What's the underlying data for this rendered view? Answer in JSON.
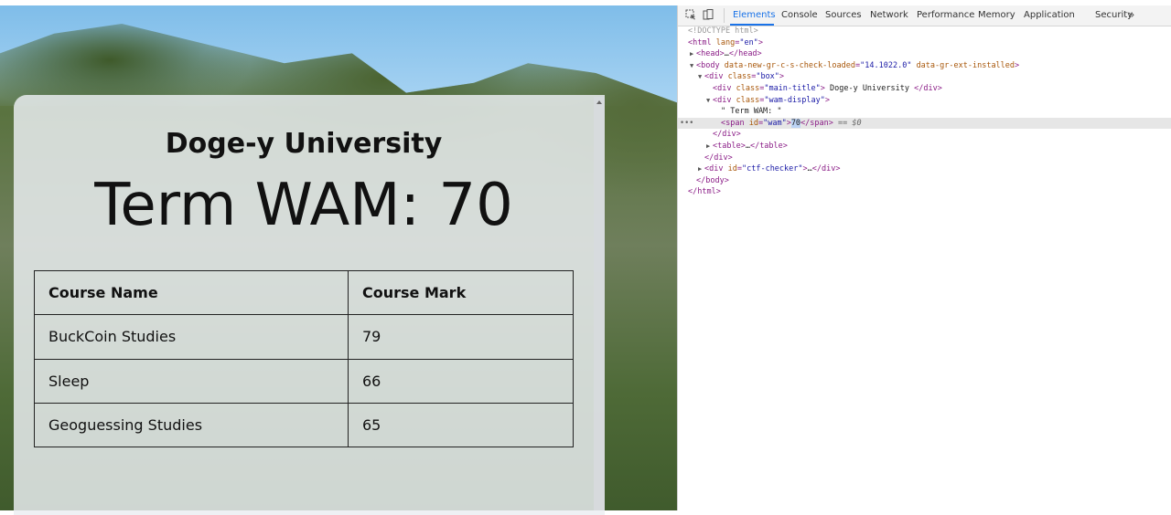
{
  "page": {
    "main_title": "Doge-y University",
    "wam_label": "Term WAM:",
    "wam_value": "70",
    "table": {
      "headers": [
        "Course Name",
        "Course Mark"
      ],
      "rows": [
        [
          "BuckCoin Studies",
          "79"
        ],
        [
          "Sleep",
          "66"
        ],
        [
          "Geoguessing Studies",
          "65"
        ]
      ]
    }
  },
  "devtools": {
    "tabs": [
      "Elements",
      "Console",
      "Sources",
      "Network",
      "Performance",
      "Memory",
      "Application",
      "Security"
    ],
    "active_tab": "Elements",
    "more": "»",
    "icons": [
      "inspect-element-icon",
      "device-toolbar-icon"
    ],
    "dom": {
      "doctype": "<!DOCTYPE html>",
      "html_open": "<html",
      "html_attr_name": "lang",
      "html_attr_val": "\"en\"",
      "head_open": "<head>",
      "head_ellipsis": "…",
      "head_close": "</head>",
      "body_open": "<body",
      "body_attr1_name": "data-new-gr-c-s-check-loaded",
      "body_attr1_val": "\"14.1022.0\"",
      "body_attr2_name": "data-gr-ext-installed",
      "div_open": "<div",
      "class_name": "class",
      "box_val": "\"box\"",
      "main_title_val": "\"main-title\"",
      "main_title_text": " Doge-y University ",
      "div_close": "</div>",
      "wam_display_val": "\"wam-display\"",
      "term_wam_text": "\" Term WAM: \"",
      "span_open": "<span",
      "id_name": "id",
      "wam_id_val": "\"wam\"",
      "wam_text": "70",
      "span_close": "</span>",
      "selected_marker": "== $0",
      "table_open": "<table>",
      "table_ellipsis": "…",
      "table_close": "</table>",
      "ctf_id_val": "\"ctf-checker\"",
      "ctf_ellipsis": "…",
      "body_close": "</body>",
      "html_close": "</html>",
      "ellipsis_marker": "•••"
    }
  }
}
